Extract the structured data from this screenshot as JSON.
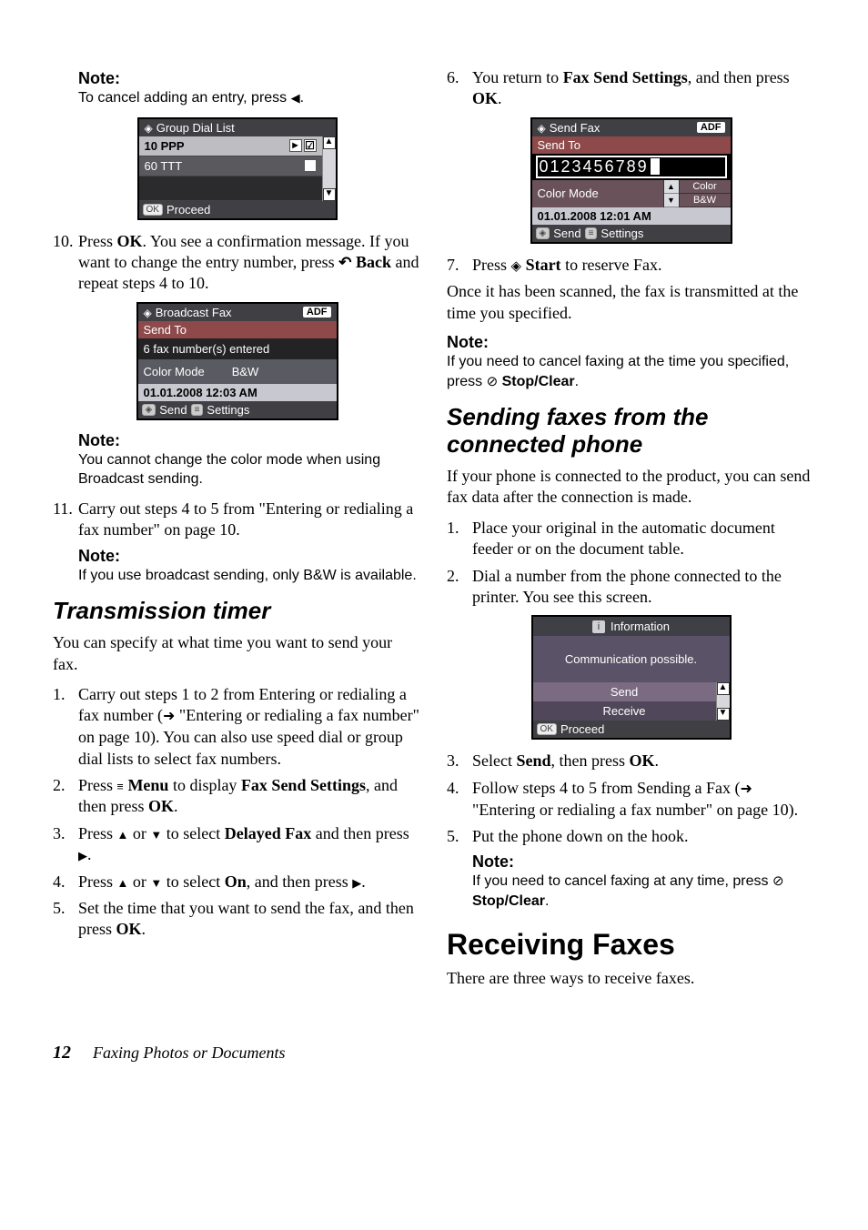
{
  "left": {
    "note1_label": "Note:",
    "note1_text_a": "To cancel adding an entry, press ",
    "note1_text_b": ".",
    "shot1": {
      "title": "Group Dial List",
      "rows": [
        "10 PPP",
        "60 TTT"
      ],
      "footer": "Proceed"
    },
    "step10_num": "10.",
    "step10_a": "Press ",
    "step10_ok": "OK",
    "step10_b": ". You see a confirmation message. If you want to change the entry number, press ",
    "step10_back": "Back",
    "step10_c": " and  repeat steps 4 to 10.",
    "shot2": {
      "title": "Broadcast Fax",
      "sendto": "Send To",
      "entered": "6 fax number(s) entered",
      "colormode": "Color Mode",
      "bw": "B&W",
      "datetime": "01.01.2008  12:03 AM",
      "foot_send": "Send",
      "foot_settings": "Settings",
      "adf": "ADF"
    },
    "note2_label": "Note:",
    "note2_text": "You cannot change the color mode when using Broadcast sending.",
    "step11_num": "11.",
    "step11_text": "Carry out steps 4 to 5 from \"Entering or redialing a fax number\" on page 10.",
    "note3_label": "Note:",
    "note3_text": "If you use broadcast sending, only B&W is available.",
    "h2_timer": "Transmission timer",
    "timer_intro": "You can specify at what time you want to send your fax.",
    "t1_num": "1.",
    "t1_a": "Carry out steps 1 to 2 from Entering or redialing a fax number (",
    "t1_b": " \"Entering or redialing a fax number\" on page 10). You can also use speed dial or group dial lists to select fax numbers.",
    "t2_num": "2.",
    "t2_a": "Press ",
    "t2_menu": "Menu",
    "t2_b": " to display ",
    "t2_fss": "Fax Send Settings",
    "t2_c": ", and then press ",
    "t2_ok": "OK",
    "t2_d": ".",
    "t3_num": "3.",
    "t3_a": "Press ",
    "t3_b": " or ",
    "t3_c": " to select ",
    "t3_delayed": "Delayed Fax",
    "t3_d": " and then press ",
    "t3_e": ".",
    "t4_num": "4.",
    "t4_a": "Press ",
    "t4_b": " or ",
    "t4_c": " to select ",
    "t4_on": "On",
    "t4_d": ", and then press ",
    "t4_e": ".",
    "t5_num": "5.",
    "t5_a": "Set the time that you want to send the fax, and then press ",
    "t5_ok": "OK",
    "t5_b": "."
  },
  "right": {
    "r6_num": "6.",
    "r6_a": "You return to ",
    "r6_fss": "Fax Send Settings",
    "r6_b": ", and then press ",
    "r6_ok": "OK",
    "r6_c": ".",
    "shot3": {
      "title": "Send Fax",
      "adf": "ADF",
      "sendto": "Send To",
      "number": "0123456789",
      "colormode": "Color Mode",
      "opt_color": "Color",
      "opt_bw": "B&W",
      "datetime": "01.01.2008  12:01 AM",
      "foot_send": "Send",
      "foot_settings": "Settings"
    },
    "r7_num": "7.",
    "r7_a": "Press ",
    "r7_start": "Start",
    "r7_b": " to reserve Fax.",
    "scanned": "Once it has been scanned, the fax is transmitted at the time you specified.",
    "note4_label": "Note:",
    "note4_a": "If you need to cancel faxing at the time you specified, press ",
    "note4_stop": "Stop/Clear",
    "note4_b": ".",
    "h2_phone": "Sending faxes from the connected phone",
    "phone_intro": "If your phone is connected to the product, you can send fax data after the connection is made.",
    "p1_num": "1.",
    "p1_text": "Place your original in the automatic document feeder or on the document table.",
    "p2_num": "2.",
    "p2_text": "Dial a number from the phone connected to the printer. You see this screen.",
    "shot4": {
      "title": "Information",
      "msg": "Communication possible.",
      "send": "Send",
      "receive": "Receive",
      "footer": "Proceed"
    },
    "p3_num": "3.",
    "p3_a": "Select ",
    "p3_send": "Send",
    "p3_b": ", then press ",
    "p3_ok": "OK",
    "p3_c": ".",
    "p4_num": "4.",
    "p4_a": "Follow steps 4 to 5 from Sending a Fax (",
    "p4_b": " \"Entering or redialing a fax number\" on page 10).",
    "p5_num": "5.",
    "p5_text": "Put the phone down on the hook.",
    "note5_label": "Note:",
    "note5_a": "If you need to cancel faxing at any time, press ",
    "note5_stop": "Stop/Clear",
    "note5_b": ".",
    "h1_recv": "Receiving Faxes",
    "recv_intro": "There are three ways to receive faxes."
  },
  "footer": {
    "page": "12",
    "title": "Faxing Photos or Documents"
  }
}
